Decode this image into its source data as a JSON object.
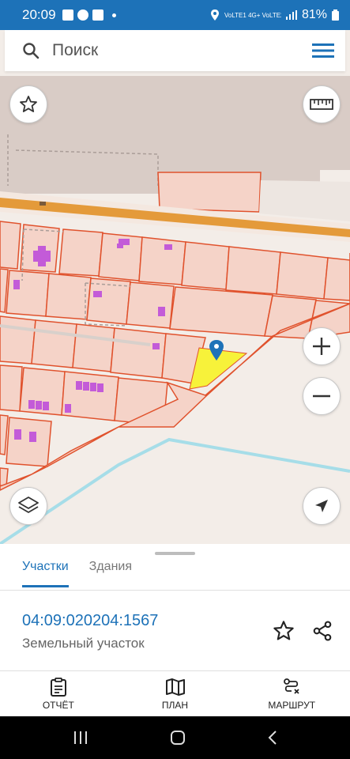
{
  "status_bar": {
    "time": "20:09",
    "signal_text": "VoLTE1 4G+ VoLTE2",
    "battery": "81%"
  },
  "search": {
    "placeholder": "Поиск"
  },
  "map": {
    "colors": {
      "parcel_fill": "#f5d3c8",
      "parcel_stroke": "#e0522d",
      "road": "#e49a3a",
      "building": "#c35bd8",
      "selected": "#f7f23a",
      "river": "#a6dde8",
      "background": "#f3ede8",
      "marker": "#1d72b8"
    }
  },
  "sheet": {
    "tabs": [
      {
        "label": "Участки",
        "active": true
      },
      {
        "label": "Здания",
        "active": false
      }
    ],
    "parcel": {
      "id": "04:09:020204:1567",
      "type": "Земельный участок"
    }
  },
  "bottom_nav": {
    "report": "ОТЧЁТ",
    "plan": "ПЛАН",
    "route": "МАРШРУТ"
  },
  "icons": {
    "search": "search-icon",
    "menu": "hamburger-menu-icon",
    "favorite": "star-icon",
    "ruler": "ruler-icon",
    "zoom_in": "plus-icon",
    "zoom_out": "minus-icon",
    "layers": "layers-icon",
    "locate": "navigation-arrow-icon",
    "share": "share-icon"
  }
}
